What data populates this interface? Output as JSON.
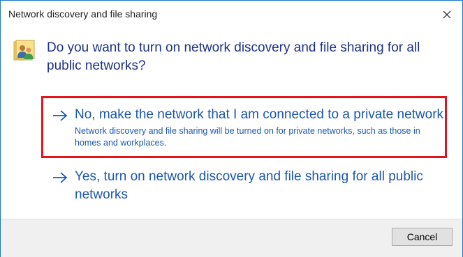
{
  "window": {
    "title": "Network discovery and file sharing",
    "close_icon": "close-icon"
  },
  "dialog": {
    "icon": "network-users-icon",
    "main_instruction": "Do you want to turn on network discovery and file sharing for all public networks?",
    "options": [
      {
        "icon": "arrow-right-icon",
        "title": "No, make the network that I am connected to a private network",
        "note": "Network discovery and file sharing will be turned on for private networks, such as those in homes and workplaces.",
        "highlighted": true
      },
      {
        "icon": "arrow-right-icon",
        "title": "Yes, turn on network discovery and file sharing for all public networks",
        "note": ""
      }
    ]
  },
  "footer": {
    "cancel_label": "Cancel"
  },
  "colors": {
    "window_border": "#1979ca",
    "instruction_text": "#1e3287",
    "link_text": "#1b57b1",
    "highlight_border": "#e3141b",
    "footer_bg": "#f0f0f0"
  }
}
